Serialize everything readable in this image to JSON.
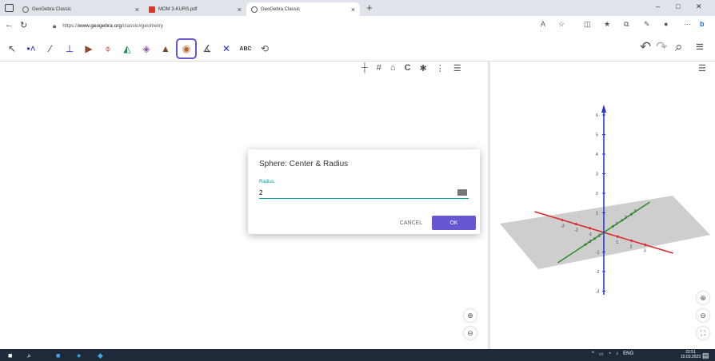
{
  "browser": {
    "tabs": [
      {
        "label": "GeoGebra Classic",
        "active": false
      },
      {
        "label": "MOM 3-KURS.pdf",
        "active": false
      },
      {
        "label": "GeoGebra Classic",
        "active": true
      }
    ],
    "new_tab_label": "+",
    "url_prefix": "https://",
    "url_host": "www.geogebra.org",
    "url_path": "/classic#geometry",
    "window_controls": [
      "–",
      "□",
      "✕"
    ]
  },
  "toolbar": {
    "tools": [
      "move-tool",
      "point-tool",
      "line-tool",
      "perpendicular-tool",
      "polygon-tool",
      "rotate-around-line-tool",
      "pyramid-tool",
      "plane-tool",
      "net-tool",
      "sphere-tool",
      "angle-tool",
      "reflect-tool",
      "text-tool",
      "view-tool"
    ],
    "text_tool_label": "ABC",
    "selected_tool": "sphere-tool"
  },
  "dialog": {
    "title": "Sphere: Center & Radius",
    "radius_label": "Radius",
    "radius_value": "2",
    "cancel_label": "CANCEL",
    "ok_label": "OK"
  },
  "view3d": {
    "z_ticks": [
      "6",
      "5",
      "4",
      "3",
      "2",
      "1",
      "-1",
      "-2",
      "-3"
    ],
    "x_ticks": [
      "-3",
      "-2",
      "-1",
      "1",
      "2",
      "3"
    ],
    "y_ticks": [
      "3",
      "2",
      "1",
      "-1",
      "-2"
    ],
    "axis_colors": {
      "x": "#d9262b",
      "y": "#2a8a2a",
      "z": "#2233cc"
    },
    "plane_color": "#bdbdbd"
  },
  "taskbar": {
    "time": "22:51",
    "date": "10.03.2023",
    "language": "ENG"
  }
}
